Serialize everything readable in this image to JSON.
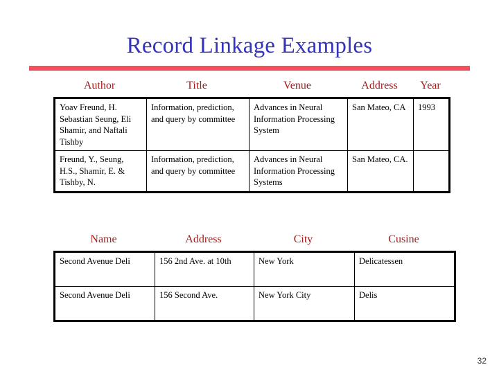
{
  "slide": {
    "title": "Record Linkage Examples",
    "page_number": "32",
    "accent_rule_color": "#f2505a",
    "title_color": "#3333bb",
    "header_color": "#a81b1b"
  },
  "tables": [
    {
      "name": "publications",
      "columns": [
        "Author",
        "Title",
        "Venue",
        "Address",
        "Year"
      ],
      "rows": [
        [
          "Yoav Freund, H. Sebastian Seung, Eli Shamir, and Naftali Tishby",
          "Information, prediction, and query by committee",
          "Advances in Neural Information Processing System",
          "San Mateo, CA",
          "1993"
        ],
        [
          "Freund, Y., Seung, H.S., Shamir, E. & Tishby, N.",
          "Information, prediction, and query by committee",
          "Advances in Neural Information Processing Systems",
          "San Mateo, CA.",
          ""
        ]
      ]
    },
    {
      "name": "restaurants",
      "columns": [
        "Name",
        "Address",
        "City",
        "Cusine"
      ],
      "rows": [
        [
          "Second Avenue Deli",
          "156 2nd Ave. at 10th",
          "New York",
          "Delicatessen"
        ],
        [
          "Second Avenue Deli",
          "156 Second Ave.",
          "New York City",
          "Delis"
        ]
      ]
    }
  ]
}
